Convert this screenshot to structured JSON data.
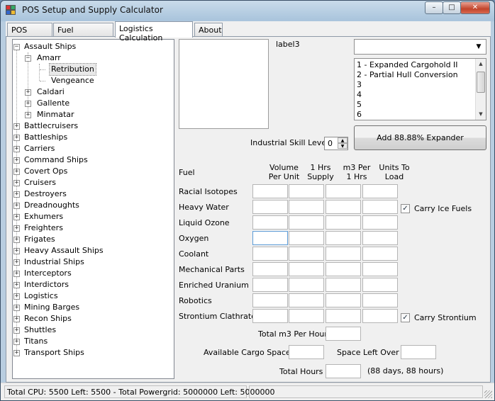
{
  "window": {
    "title": "POS Setup and Supply Calculator",
    "minimize": "–",
    "maximize": "□",
    "close": "✕"
  },
  "tabs": [
    {
      "label": "POS Setup"
    },
    {
      "label": "Fuel Calculation"
    },
    {
      "label": "Logistics Calculation"
    },
    {
      "label": "About"
    }
  ],
  "tree": {
    "expander_collapsed": "+",
    "expander_expanded": "−",
    "assault_ships": "Assault Ships",
    "amarr": "Amarr",
    "retribution": "Retribution",
    "vengeance": "Vengeance",
    "caldari": "Caldari",
    "gallente": "Gallente",
    "minmatar": "Minmatar",
    "categories": [
      "Battlecruisers",
      "Battleships",
      "Carriers",
      "Command Ships",
      "Covert Ops",
      "Cruisers",
      "Destroyers",
      "Dreadnoughts",
      "Exhumers",
      "Freighters",
      "Frigates",
      "Heavy Assault Ships",
      "Industrial Ships",
      "Interceptors",
      "Interdictors",
      "Logistics",
      "Mining Barges",
      "Recon Ships",
      "Shuttles",
      "Titans",
      "Transport Ships"
    ]
  },
  "ship": {
    "label3": "label3",
    "skill_label": "Industrial Skill Level",
    "skill_value": "0",
    "combo_arrow": "▼",
    "expander_options": [
      "1 - Expanded Cargohold II",
      "2 - Partial Hull Conversion",
      "3",
      "4",
      "5",
      "6"
    ],
    "add_button": "Add 88.88% Expander"
  },
  "fuel_table": {
    "fuel_header": "Fuel",
    "col_volume": [
      "Volume",
      "Per Unit"
    ],
    "col_supply": [
      "1 Hrs",
      "Supply"
    ],
    "col_m3": [
      "m3 Per",
      "1 Hrs"
    ],
    "col_units": [
      "Units To",
      "Load"
    ],
    "rows": [
      "Racial Isotopes",
      "Heavy Water",
      "Liquid Ozone",
      "Oxygen",
      "Coolant",
      "Mechanical Parts",
      "Enriched Uranium",
      "Robotics",
      "Strontium Clathrates"
    ],
    "carry_ice": "Carry Ice Fuels",
    "carry_ice_checked": "✓",
    "carry_strontium": "Carry Strontium",
    "carry_strontium_checked": "✓"
  },
  "totals": {
    "total_m3": "Total m3 Per Hour",
    "available_cargo": "Available Cargo Space",
    "space_left": "Space Left Over",
    "total_hours": "Total Hours",
    "duration": "(88 days, 88 hours)"
  },
  "status": {
    "text": "Total CPU: 5500 Left: 5500 - Total Powergrid: 5000000 Left: 5000000"
  }
}
